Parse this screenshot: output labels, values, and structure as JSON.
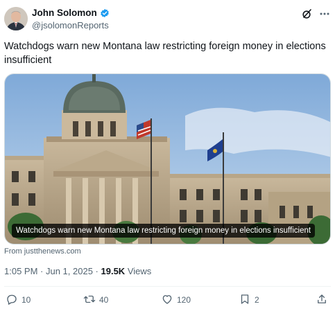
{
  "author": {
    "name": "John Solomon",
    "handle": "@jsolomonReports",
    "verified_color": "#1d9bf0"
  },
  "tweet": {
    "text": "Watchdogs warn new Montana law restricting foreign money in elections insufficient"
  },
  "card": {
    "caption": "Watchdogs warn new Montana law restricting foreign money in elections insufficient",
    "source": "From justthenews.com"
  },
  "meta": {
    "time": "1:05 PM",
    "separator": " · ",
    "date": "Jun 1, 2025",
    "views_count": "19.5K",
    "views_label": "Views"
  },
  "actions": {
    "replies": "10",
    "reposts": "40",
    "likes": "120",
    "bookmarks": "2"
  },
  "icons": [
    "grok-icon",
    "more-icon",
    "reply-icon",
    "repost-icon",
    "like-icon",
    "bookmark-icon",
    "share-icon",
    "verified-badge-icon"
  ]
}
